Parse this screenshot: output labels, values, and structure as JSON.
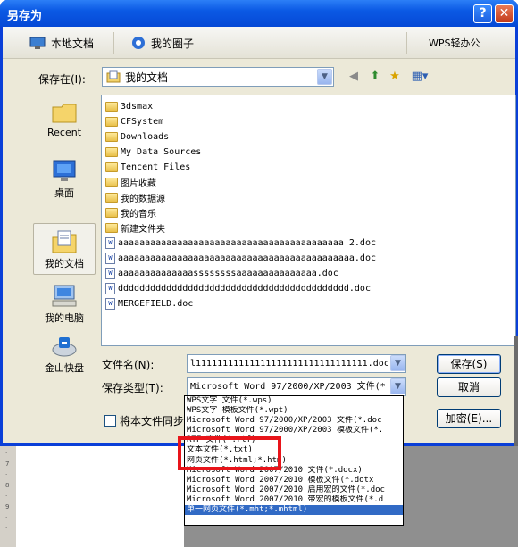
{
  "window": {
    "title": "另存为",
    "help_symbol": "?",
    "close_symbol": "✕"
  },
  "tabs": {
    "local": "本地文档",
    "circle": "我的圈子",
    "wps": "WPS轻办公"
  },
  "save_in": {
    "label": "保存在(I):",
    "value": "我的文档"
  },
  "places": [
    {
      "label": "Recent",
      "icon": "recent-folder-icon"
    },
    {
      "label": "桌面",
      "icon": "desktop-icon"
    },
    {
      "label": "我的文档",
      "icon": "my-documents-icon"
    },
    {
      "label": "我的电脑",
      "icon": "my-computer-icon"
    },
    {
      "label": "金山快盘",
      "icon": "kuaipan-icon"
    }
  ],
  "files": [
    {
      "name": "3dsmax",
      "kind": "folder"
    },
    {
      "name": "CFSystem",
      "kind": "folder"
    },
    {
      "name": "Downloads",
      "kind": "folder"
    },
    {
      "name": "My Data Sources",
      "kind": "folder"
    },
    {
      "name": "Tencent Files",
      "kind": "folder"
    },
    {
      "name": "图片收藏",
      "kind": "folder"
    },
    {
      "name": "我的数据源",
      "kind": "folder"
    },
    {
      "name": "我的音乐",
      "kind": "folder"
    },
    {
      "name": "新建文件夹",
      "kind": "folder"
    },
    {
      "name": "aaaaaaaaaaaaaaaaaaaaaaaaaaaaaaaaaaaaaaaaaa 2.doc",
      "kind": "doc"
    },
    {
      "name": "aaaaaaaaaaaaaaaaaaaaaaaaaaaaaaaaaaaaaaaaaaaa.doc",
      "kind": "doc"
    },
    {
      "name": "aaaaaaaaaaaaaassssssssaaaaaaaaaaaaaaa.doc",
      "kind": "doc"
    },
    {
      "name": "ddddddddddddddddddddddddddddddddddddddddddd.doc",
      "kind": "doc"
    },
    {
      "name": "MERGEFIELD.doc",
      "kind": "doc"
    }
  ],
  "filename": {
    "label": "文件名(N):",
    "value": "l11111111111111111111111111111111.doc"
  },
  "filetype": {
    "label": "保存类型(T):",
    "value": "Microsoft Word 97/2000/XP/2003 文件(*"
  },
  "sync": {
    "label": "将本文件同步备"
  },
  "buttons": {
    "save": "保存(S)",
    "cancel": "取消",
    "encrypt": "加密(E)..."
  },
  "dropdown_options": [
    "WPS文字 文件(*.wps)",
    "WPS文字 模板文件(*.wpt)",
    "Microsoft Word 97/2000/XP/2003 文件(*.doc",
    "Microsoft Word 97/2000/XP/2003 模板文件(*.",
    "RTF 文件(*.rtf)",
    "文本文件(*.txt)",
    "网页文件(*.html;*.htm)",
    "Microsoft Word 2007/2010 文件(*.docx)",
    "Microsoft Word 2007/2010 模板文件(*.dotx",
    "Microsoft Word 2007/2010 启用宏的文件(*.doc",
    "Microsoft Word 2007/2010 带宏的模板文件(*.d",
    "单一网页文件(*.mht;*.mhtml)"
  ],
  "dropdown_selected_index": 11,
  "colors": {
    "titlebar": "#0b59e4",
    "selection": "#316ac5",
    "highlight_box": "#e8141a"
  }
}
